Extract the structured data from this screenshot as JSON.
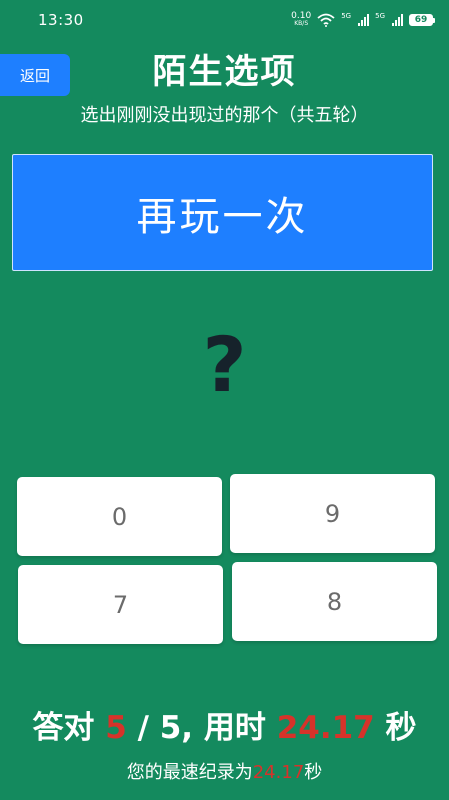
{
  "status": {
    "time": "13:30",
    "net_speed": "0.10",
    "net_unit": "KB/S",
    "sim1": "5G",
    "sim2": "5G",
    "battery": "69"
  },
  "header": {
    "back_label": "返回",
    "title": "陌生选项",
    "subtitle": "选出刚刚没出现过的那个（共五轮）"
  },
  "replay_label": "再玩一次",
  "question_symbol": "?",
  "options": [
    {
      "label": "0"
    },
    {
      "label": "9"
    },
    {
      "label": "7"
    },
    {
      "label": "8"
    }
  ],
  "score": {
    "prefix": "答对",
    "correct": "5",
    "separator": "/",
    "total": "5,",
    "time_prefix": "用时",
    "time": "24.17",
    "unit": "秒"
  },
  "record": {
    "prefix": "您的最速纪录为",
    "time": "24.17",
    "unit": "秒"
  },
  "colors": {
    "background": "#148a5e",
    "accent_blue": "#1e7fff",
    "highlight_red": "#d6332a"
  }
}
